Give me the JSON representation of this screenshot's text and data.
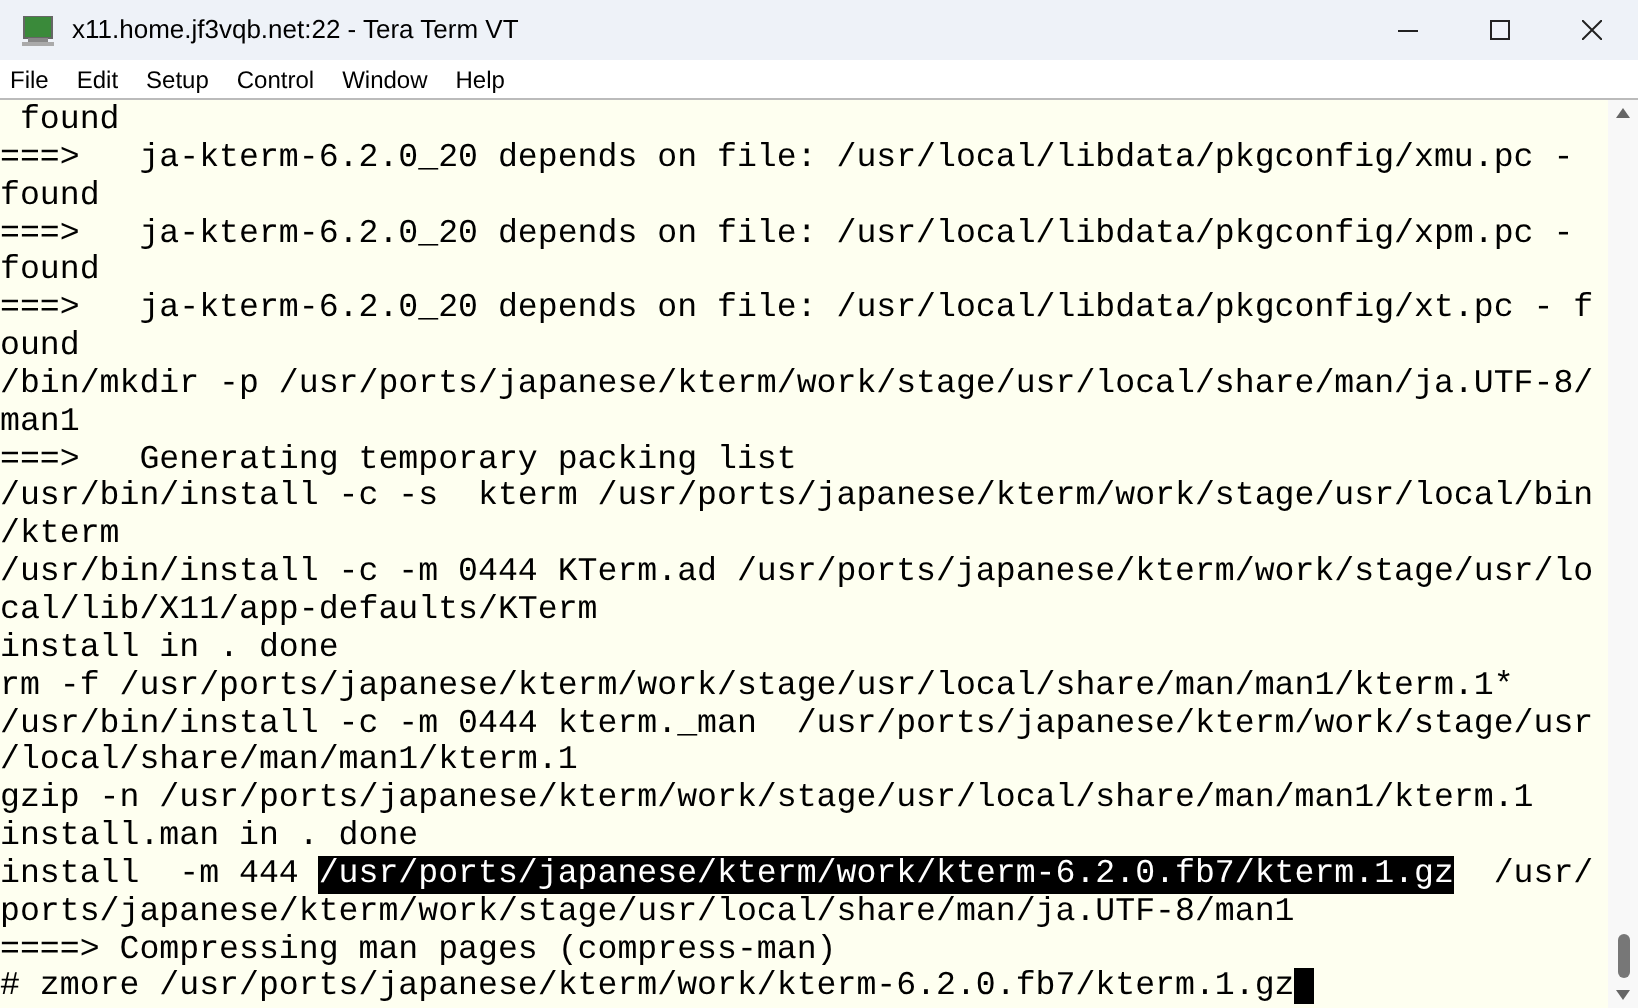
{
  "window": {
    "title": "x11.home.jf3vqb.net:22 - Tera Term VT"
  },
  "menu": [
    "File",
    "Edit",
    "Setup",
    "Control",
    "Window",
    "Help"
  ],
  "terminal": {
    "lines": [
      {
        "segments": [
          {
            "text": " found",
            "selected": false
          }
        ]
      },
      {
        "segments": [
          {
            "text": "===>   ja-kterm-6.2.0_20 depends on file: /usr/local/libdata/pkgconfig/xmu.pc -",
            "selected": false
          }
        ]
      },
      {
        "segments": [
          {
            "text": "found",
            "selected": false
          }
        ]
      },
      {
        "segments": [
          {
            "text": "===>   ja-kterm-6.2.0_20 depends on file: /usr/local/libdata/pkgconfig/xpm.pc -",
            "selected": false
          }
        ]
      },
      {
        "segments": [
          {
            "text": "found",
            "selected": false
          }
        ]
      },
      {
        "segments": [
          {
            "text": "===>   ja-kterm-6.2.0_20 depends on file: /usr/local/libdata/pkgconfig/xt.pc - f",
            "selected": false
          }
        ]
      },
      {
        "segments": [
          {
            "text": "ound",
            "selected": false
          }
        ]
      },
      {
        "segments": [
          {
            "text": "/bin/mkdir -p /usr/ports/japanese/kterm/work/stage/usr/local/share/man/ja.UTF-8/",
            "selected": false
          }
        ]
      },
      {
        "segments": [
          {
            "text": "man1",
            "selected": false
          }
        ]
      },
      {
        "segments": [
          {
            "text": "===>   Generating temporary packing list",
            "selected": false
          }
        ]
      },
      {
        "segments": [
          {
            "text": "/usr/bin/install -c -s  kterm /usr/ports/japanese/kterm/work/stage/usr/local/bin",
            "selected": false
          }
        ]
      },
      {
        "segments": [
          {
            "text": "/kterm",
            "selected": false
          }
        ]
      },
      {
        "segments": [
          {
            "text": "/usr/bin/install -c -m 0444 KTerm.ad /usr/ports/japanese/kterm/work/stage/usr/lo",
            "selected": false
          }
        ]
      },
      {
        "segments": [
          {
            "text": "cal/lib/X11/app-defaults/KTerm",
            "selected": false
          }
        ]
      },
      {
        "segments": [
          {
            "text": "install in . done",
            "selected": false
          }
        ]
      },
      {
        "segments": [
          {
            "text": "rm -f /usr/ports/japanese/kterm/work/stage/usr/local/share/man/man1/kterm.1*",
            "selected": false
          }
        ]
      },
      {
        "segments": [
          {
            "text": "/usr/bin/install -c -m 0444 kterm._man  /usr/ports/japanese/kterm/work/stage/usr",
            "selected": false
          }
        ]
      },
      {
        "segments": [
          {
            "text": "/local/share/man/man1/kterm.1",
            "selected": false
          }
        ]
      },
      {
        "segments": [
          {
            "text": "gzip -n /usr/ports/japanese/kterm/work/stage/usr/local/share/man/man1/kterm.1",
            "selected": false
          }
        ]
      },
      {
        "segments": [
          {
            "text": "install.man in . done",
            "selected": false
          }
        ]
      },
      {
        "segments": [
          {
            "text": "install  -m 444 ",
            "selected": false
          },
          {
            "text": "/usr/ports/japanese/kterm/work/kterm-6.2.0.fb7/kterm.1.gz",
            "selected": true
          },
          {
            "text": "  /usr/",
            "selected": false
          }
        ]
      },
      {
        "segments": [
          {
            "text": "ports/japanese/kterm/work/stage/usr/local/share/man/ja.UTF-8/man1",
            "selected": false
          }
        ]
      },
      {
        "segments": [
          {
            "text": "====> Compressing man pages (compress-man)",
            "selected": false
          }
        ]
      },
      {
        "segments": [
          {
            "text": "# zmore /usr/ports/japanese/kterm/work/kterm-6.2.0.fb7/kterm.1.gz",
            "selected": false
          }
        ],
        "cursor": true
      }
    ]
  }
}
